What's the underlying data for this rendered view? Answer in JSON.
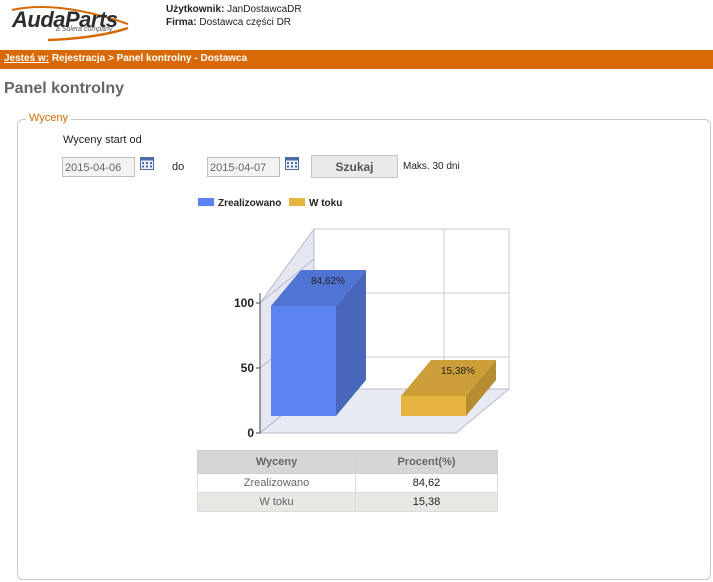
{
  "header": {
    "logo_text": "AudaParts",
    "logo_subtext": "a Solera company",
    "user_label": "Użytkownik:",
    "user_value": "JanDostawcaDR",
    "company_label": "Firma:",
    "company_value": "Dostawca części DR"
  },
  "breadcrumb": {
    "here_label": "Jesteś w:",
    "path": "Rejestracja > Panel kontrolny - Dostawca"
  },
  "page_title": "Panel kontrolny",
  "panel": {
    "legend": "Wyceny",
    "start_label": "Wyceny start od",
    "date_from": "2015-04-06",
    "to_label": "do",
    "date_to": "2015-04-07",
    "search_button": "Szukaj",
    "max_note": "Maks. 30 dni"
  },
  "colors": {
    "accent": "#d86a05",
    "series_done": "#5b84f0",
    "series_in_progress": "#e8b440"
  },
  "icons": {
    "calendar": "calendar-icon"
  },
  "chart_data": {
    "type": "bar",
    "categories": [
      "Zrealizowano",
      "W toku"
    ],
    "values": [
      84.62,
      15.38
    ],
    "value_labels": [
      "84,62%",
      "15,38%"
    ],
    "legend": [
      "Zrealizowano",
      "W toku"
    ],
    "y_ticks": [
      "0",
      "50",
      "100"
    ],
    "ylim": [
      0,
      100
    ],
    "grid": true,
    "legend_position": "top-left",
    "three_d": true
  },
  "table": {
    "headers": [
      "Wyceny",
      "Procent(%)"
    ],
    "rows": [
      {
        "name": "Zrealizowano",
        "value": "84,62"
      },
      {
        "name": "W toku",
        "value": "15,38"
      }
    ]
  }
}
